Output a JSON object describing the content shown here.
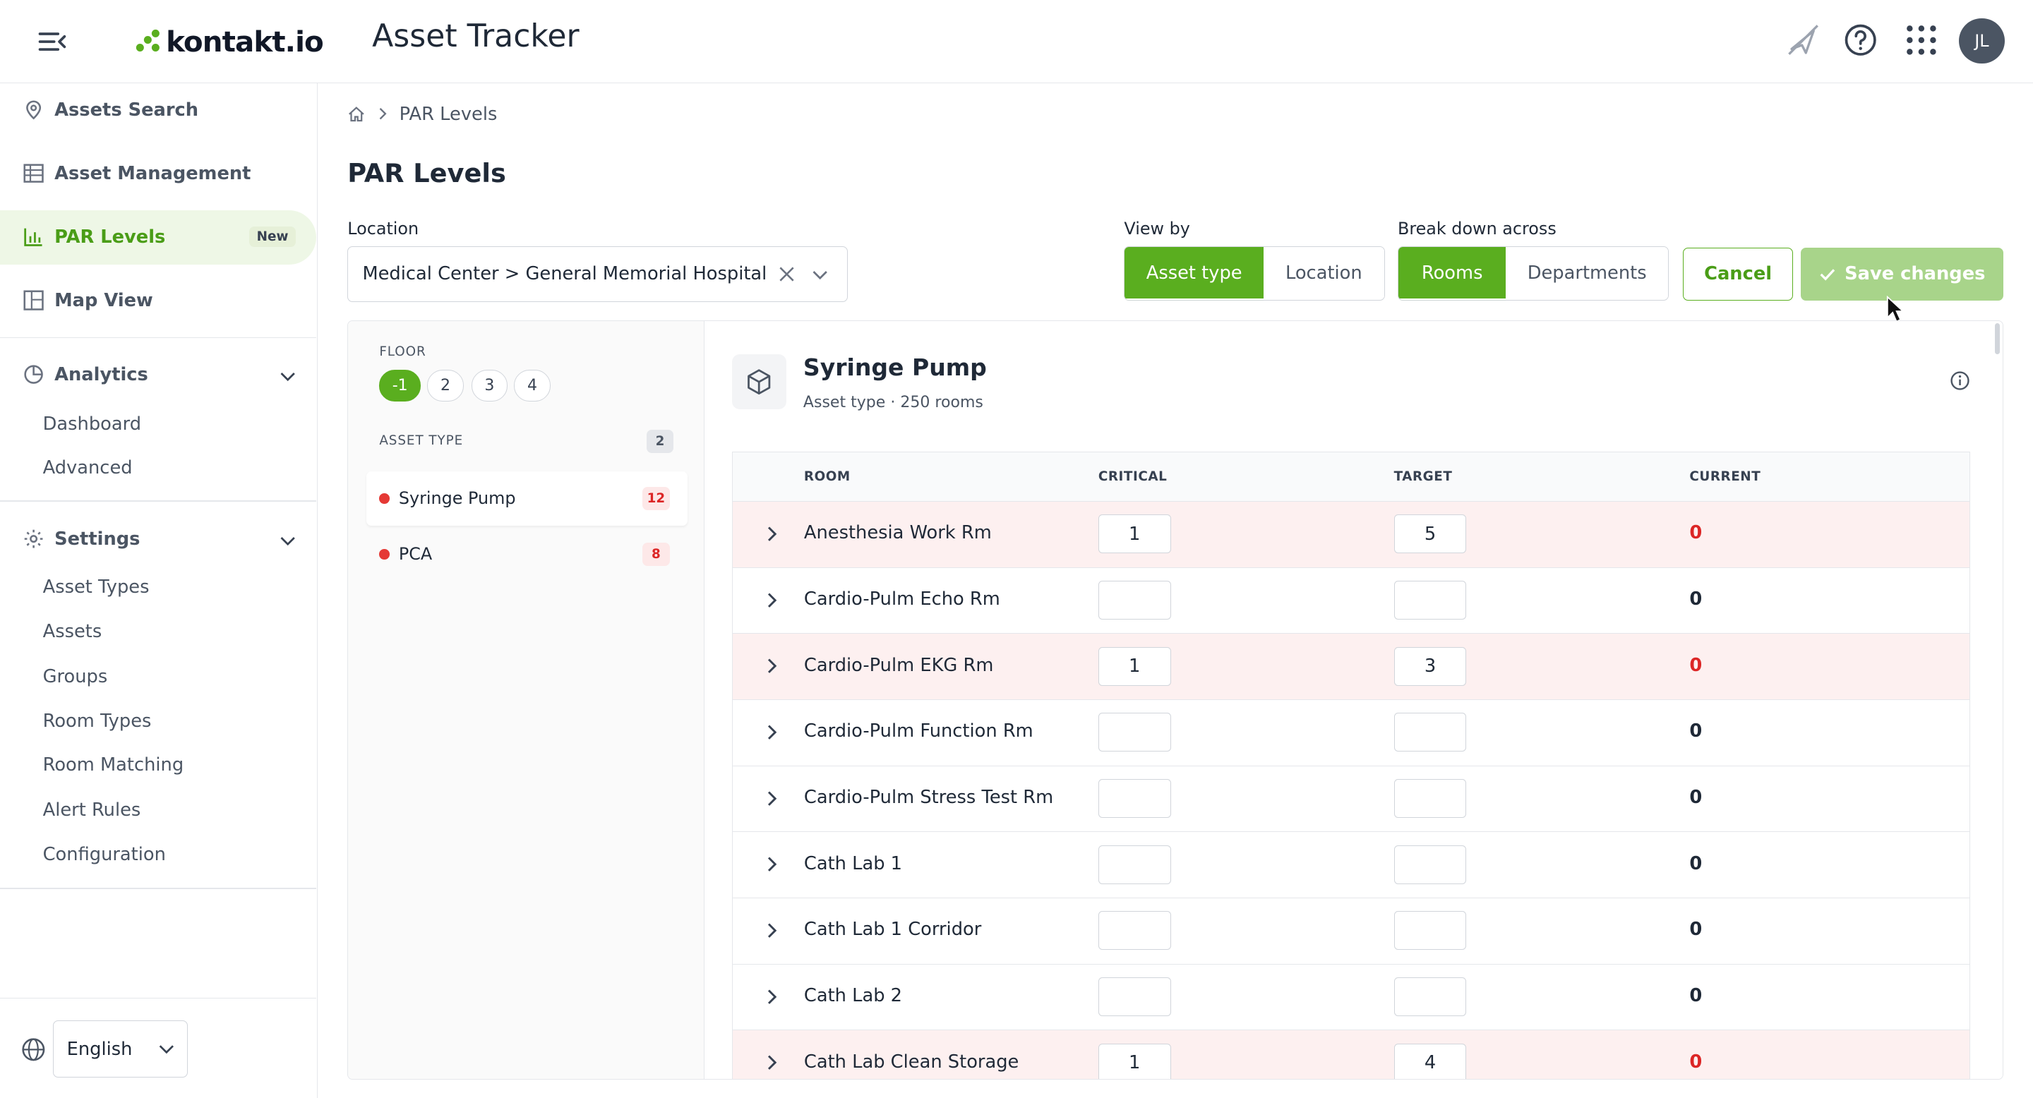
{
  "header": {
    "logo_text": "kontakt.io",
    "app_title": "Asset Tracker",
    "avatar_initials": "JL"
  },
  "sidebar": {
    "items": [
      {
        "label": "Assets Search",
        "icon": "map-pin-icon"
      },
      {
        "label": "Asset Management",
        "icon": "table-icon"
      },
      {
        "label": "PAR Levels",
        "icon": "bar-chart-icon",
        "badge": "New",
        "active": true
      },
      {
        "label": "Map View",
        "icon": "map-layout-icon"
      }
    ],
    "analytics": {
      "label": "Analytics",
      "children": [
        "Dashboard",
        "Advanced"
      ]
    },
    "settings": {
      "label": "Settings",
      "children": [
        "Asset Types",
        "Assets",
        "Groups",
        "Room Types",
        "Room Matching",
        "Alert Rules",
        "Configuration"
      ]
    },
    "language": "English"
  },
  "breadcrumb": {
    "current": "PAR Levels"
  },
  "page_title": "PAR Levels",
  "controls": {
    "location_label": "Location",
    "location_value": "Medical Center > General Memorial Hospital",
    "view_by_label": "View by",
    "view_by_options": [
      "Asset type",
      "Location"
    ],
    "view_by_selected": "Asset type",
    "breakdown_label": "Break down across",
    "breakdown_options": [
      "Rooms",
      "Departments"
    ],
    "breakdown_selected": "Rooms",
    "cancel_label": "Cancel",
    "save_label": "Save changes"
  },
  "filters": {
    "floor_label": "FLOOR",
    "floors": [
      "-1",
      "2",
      "3",
      "4"
    ],
    "selected_floor": "-1",
    "asset_type_label": "ASSET TYPE",
    "asset_type_count": "2",
    "asset_types": [
      {
        "name": "Syringe Pump",
        "count": "12",
        "selected": true
      },
      {
        "name": "PCA",
        "count": "8",
        "selected": false
      }
    ]
  },
  "asset": {
    "title": "Syringe Pump",
    "subtitle": "Asset type · 250 rooms"
  },
  "table": {
    "columns": [
      "ROOM",
      "CRITICAL",
      "TARGET",
      "CURRENT"
    ],
    "rows": [
      {
        "room": "Anesthesia Work Rm",
        "critical": "1",
        "target": "5",
        "current": "0",
        "alert": true
      },
      {
        "room": "Cardio-Pulm Echo Rm",
        "critical": "",
        "target": "",
        "current": "0",
        "alert": false
      },
      {
        "room": "Cardio-Pulm EKG Rm",
        "critical": "1",
        "target": "3",
        "current": "0",
        "alert": true
      },
      {
        "room": "Cardio-Pulm Function Rm",
        "critical": "",
        "target": "",
        "current": "0",
        "alert": false
      },
      {
        "room": "Cardio-Pulm Stress Test Rm",
        "critical": "",
        "target": "",
        "current": "0",
        "alert": false
      },
      {
        "room": "Cath Lab 1",
        "critical": "",
        "target": "",
        "current": "0",
        "alert": false
      },
      {
        "room": "Cath Lab 1 Corridor",
        "critical": "",
        "target": "",
        "current": "0",
        "alert": false
      },
      {
        "room": "Cath Lab 2",
        "critical": "",
        "target": "",
        "current": "0",
        "alert": false
      },
      {
        "room": "Cath Lab Clean Storage",
        "critical": "1",
        "target": "4",
        "current": "0",
        "alert": true
      }
    ]
  },
  "colors": {
    "accent": "#5aae1f",
    "alert_row": "#fdf0f0",
    "alert_text": "#dc2626"
  }
}
